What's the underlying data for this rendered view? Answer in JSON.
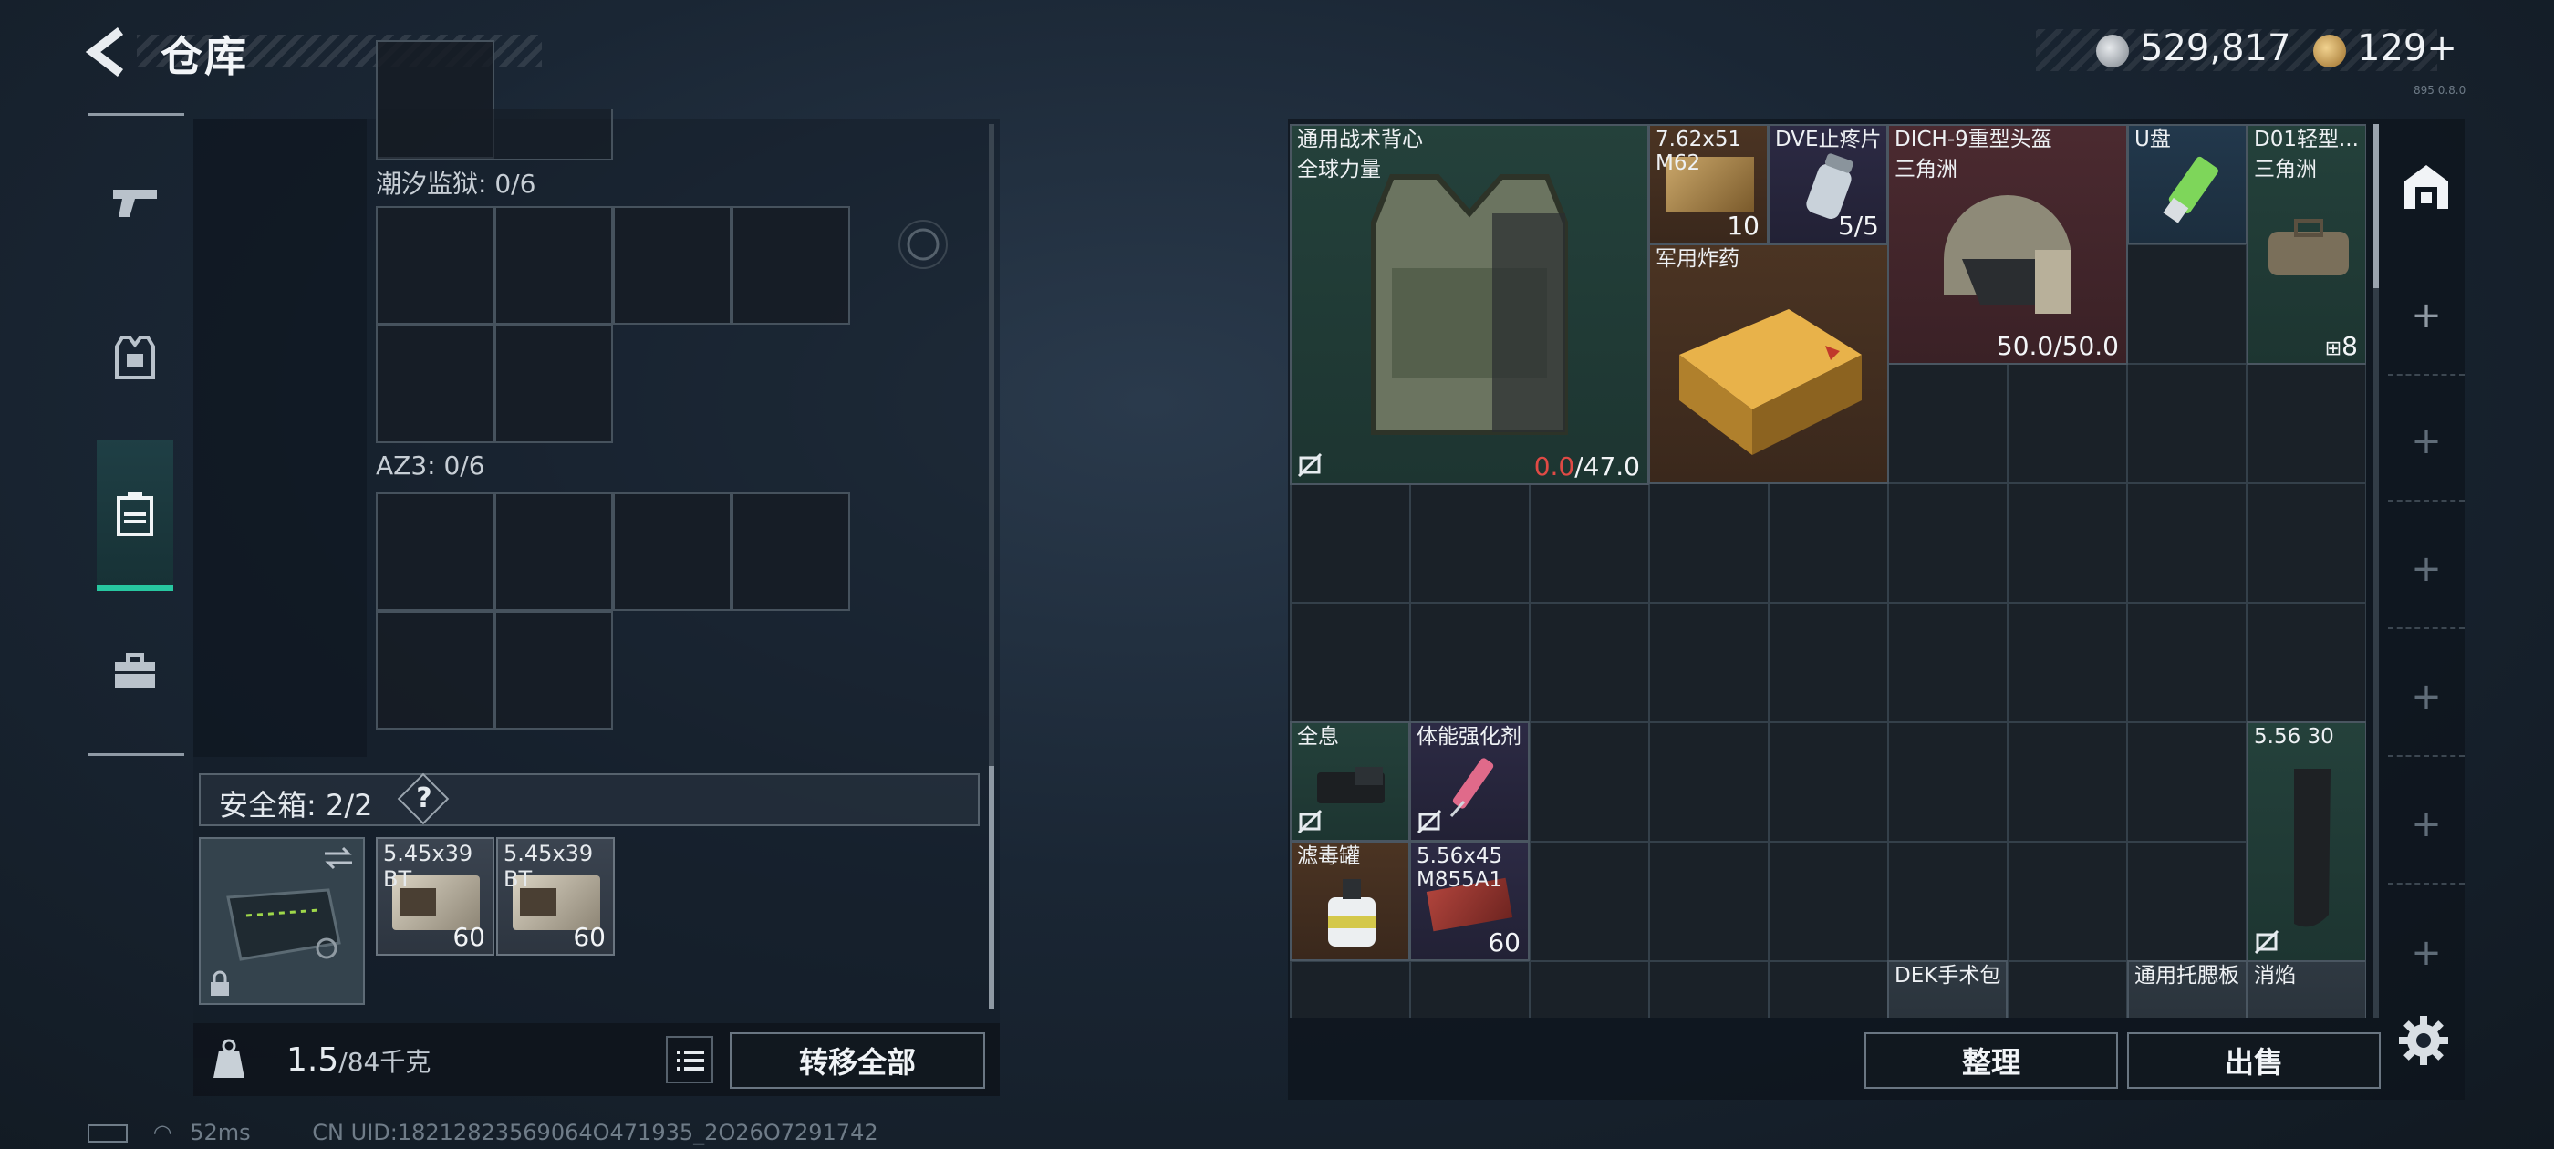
{
  "header": {
    "title": "仓库"
  },
  "currency": {
    "silver": "529,817",
    "gold": "129+"
  },
  "side_nav": {
    "items": [
      "weapon",
      "armor",
      "storage",
      "toolbox"
    ]
  },
  "left": {
    "sections": [
      {
        "label": "潮汐监狱: 0/6"
      },
      {
        "label": "AZ3: 0/6"
      }
    ],
    "safe_box": {
      "label": "安全箱: 2/2",
      "help": "?",
      "items": [
        {
          "name": "5.45x39 BT",
          "count": "60"
        },
        {
          "name": "5.45x39 BT",
          "count": "60"
        }
      ]
    },
    "weight": {
      "current": "1.5",
      "max": "/84千克"
    },
    "transfer_all": "转移全部"
  },
  "stash": {
    "items": [
      {
        "name": "通用战术背心",
        "sub": "全球力量",
        "durability_cur": "0.0",
        "durability_max": "/47.0"
      },
      {
        "name": "7.62x51",
        "sub": "M62",
        "count": "10"
      },
      {
        "name": "DVE止疼片",
        "count": "5/5"
      },
      {
        "name": "DICH-9重型头盔",
        "sub": "三角洲",
        "count": "50.0/50.0"
      },
      {
        "name": "U盘"
      },
      {
        "name": "D01轻型...",
        "sub": "三角洲",
        "count": "8"
      },
      {
        "name": "军用炸药"
      },
      {
        "name": "全息"
      },
      {
        "name": "体能强化剂"
      },
      {
        "name": "滤毒罐"
      },
      {
        "name": "5.56x45",
        "sub": "M855A1",
        "count": "60"
      },
      {
        "name": "5.56 30"
      },
      {
        "name": "DEK手术包"
      },
      {
        "name": "通用托腮板"
      },
      {
        "name": "消焰"
      }
    ],
    "sort_button": "整理",
    "sell_button": "出售"
  },
  "status": {
    "ping": "52ms",
    "uid": "CN UID:18212823569064O471935_2O26O7291742",
    "version": "895 0.8.0"
  },
  "colors": {
    "accent": "#27c7a0",
    "durability_low": "#e04a45"
  }
}
